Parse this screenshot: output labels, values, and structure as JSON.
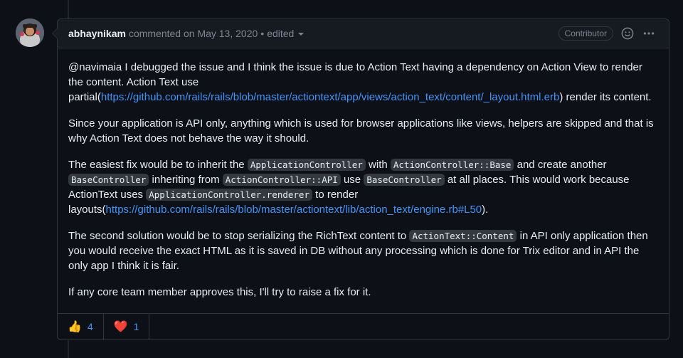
{
  "comment": {
    "author": "abhaynikam",
    "action": "commented on",
    "date": "May 13, 2020",
    "dot": "•",
    "edited": "edited",
    "badge": "Contributor",
    "paragraphs": {
      "p1_text1": "@navimaia I debugged the issue and I think the issue is due to Action Text having a dependency on Action View to render the content. Action Text use partial(",
      "p1_link": "https://github.com/rails/rails/blob/master/actiontext/app/views/action_text/content/_layout.html.erb",
      "p1_text2": ") render its content.",
      "p2": "Since your application is API only, anything which is used for browser applications like views, helpers are skipped and that is why Action Text does not behave the way it should.",
      "p3_t1": "The easiest fix would be to inherit the ",
      "p3_c1": "ApplicationController",
      "p3_t2": " with ",
      "p3_c2": "ActionController::Base",
      "p3_t3": " and create another ",
      "p3_c3": "BaseController",
      "p3_t4": " inheriting from ",
      "p3_c4": "ActionController::API",
      "p3_t5": " use ",
      "p3_c5": "BaseController",
      "p3_t6": " at all places. This would work because ActionText uses ",
      "p3_c6": "ApplicationController.renderer",
      "p3_t7": " to render layouts(",
      "p3_link": "https://github.com/rails/rails/blob/master/actiontext/lib/action_text/engine.rb#L50",
      "p3_t8": ").",
      "p4_t1": "The second solution would be to stop serializing the RichText content to ",
      "p4_c1": "ActionText::Content",
      "p4_t2": " in API only application then you would receive the exact HTML as it is saved in DB without any processing which is done for Trix editor and in API the only app I think it is fair.",
      "p5": "If any core team member approves this, I'll try to raise a fix for it."
    },
    "reactions": [
      {
        "emoji": "👍",
        "count": "4",
        "icon": "thumbs-up-icon"
      },
      {
        "emoji": "❤️",
        "count": "1",
        "icon": "heart-icon"
      }
    ]
  },
  "colors": {
    "background": "#0d1117",
    "header": "#161b22",
    "border": "#30363d",
    "link": "#4493f8",
    "text": "#e6edf3",
    "muted": "#7d8590"
  }
}
